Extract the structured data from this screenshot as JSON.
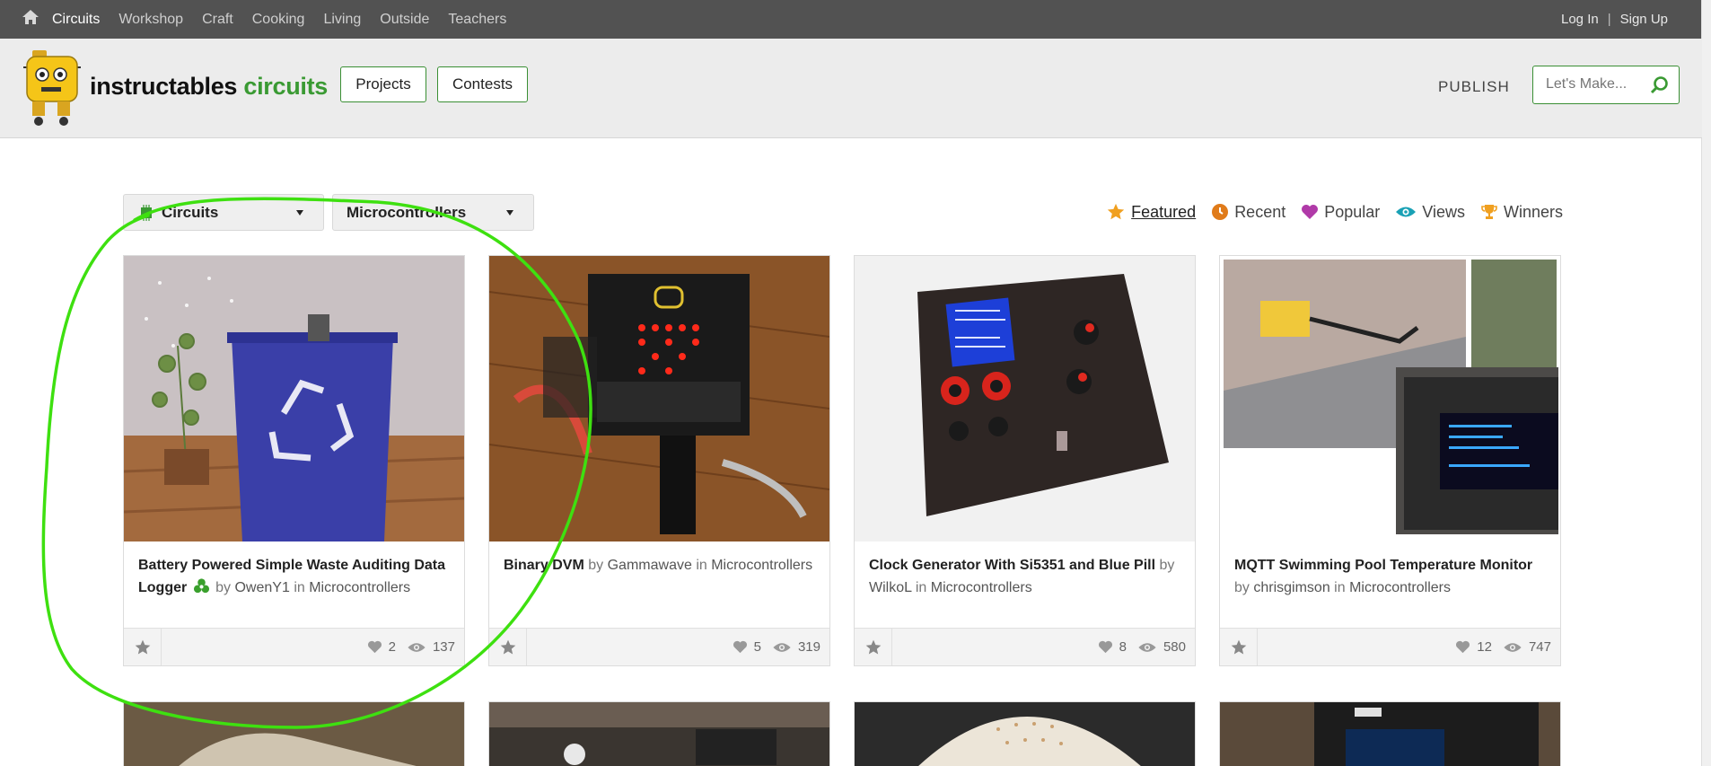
{
  "topnav": {
    "items": [
      {
        "label": "Circuits",
        "active": true
      },
      {
        "label": "Workshop"
      },
      {
        "label": "Craft"
      },
      {
        "label": "Cooking"
      },
      {
        "label": "Living"
      },
      {
        "label": "Outside"
      },
      {
        "label": "Teachers"
      }
    ],
    "login": "Log In",
    "separator": "|",
    "signup": "Sign Up"
  },
  "header": {
    "brand_name": "instructables",
    "brand_channel": "circuits",
    "projects_label": "Projects",
    "contests_label": "Contests",
    "publish_label": "PUBLISH",
    "search_placeholder": "Let's Make..."
  },
  "filters": {
    "category": "Circuits",
    "subcategory": "Microcontrollers"
  },
  "sorts": [
    {
      "label": "Featured",
      "icon": "star-icon",
      "color": "#f0a020",
      "active": true
    },
    {
      "label": "Recent",
      "icon": "clock-icon",
      "color": "#e07b1a"
    },
    {
      "label": "Popular",
      "icon": "heart-icon",
      "color": "#b03aa8"
    },
    {
      "label": "Views",
      "icon": "eye-icon",
      "color": "#19a1b5"
    },
    {
      "label": "Winners",
      "icon": "trophy-icon",
      "color": "#f0a020"
    }
  ],
  "cards": [
    {
      "title": "Battery Powered Simple Waste Auditing Data Logger",
      "by": "by",
      "author": "OwenY1",
      "in": "in",
      "category": "Microcontrollers",
      "favorites": "2",
      "views": "137",
      "badge": "recycle-icon"
    },
    {
      "title": "Binary DVM",
      "by": "by",
      "author": "Gammawave",
      "in": "in",
      "category": "Microcontrollers",
      "favorites": "5",
      "views": "319"
    },
    {
      "title": "Clock Generator With Si5351 and Blue Pill",
      "by": "by",
      "author": "WilkoL",
      "in": "in",
      "category": "Microcontrollers",
      "favorites": "8",
      "views": "580"
    },
    {
      "title": "MQTT Swimming Pool Temperature Monitor",
      "by": "by",
      "author": "chrisgimson",
      "in": "in",
      "category": "Microcontrollers",
      "favorites": "12",
      "views": "747"
    }
  ],
  "colors": {
    "brand_green": "#3a9a33",
    "annotation_green": "#3ee010",
    "topbar": "#525252"
  }
}
